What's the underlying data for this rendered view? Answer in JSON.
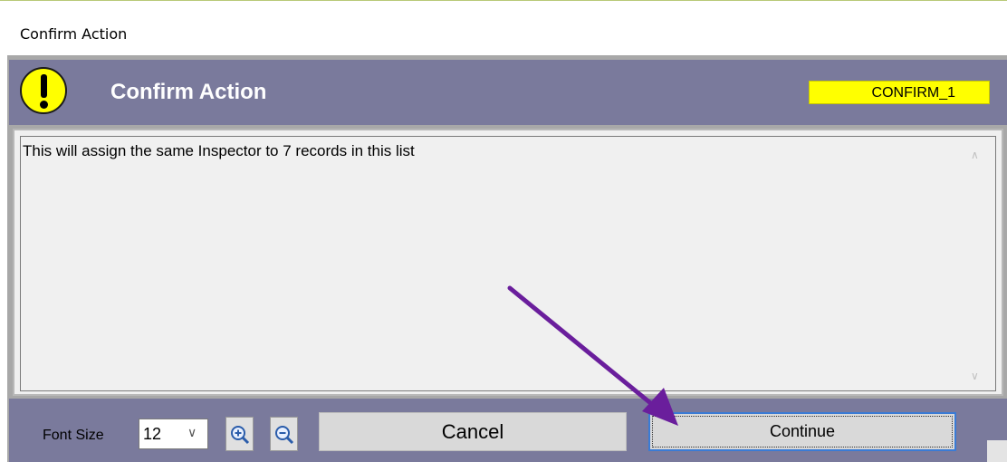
{
  "window": {
    "title": "Confirm Action"
  },
  "header": {
    "title": "Confirm Action",
    "code": "CONFIRM_1",
    "icon": "warning-icon"
  },
  "message": {
    "text": "This will assign the same Inspector to 7 records in this list"
  },
  "footer": {
    "font_size_label": "Font Size",
    "font_size_value": "12",
    "zoom_in_icon": "zoom-in-icon",
    "zoom_out_icon": "zoom-out-icon",
    "cancel_label": "Cancel",
    "continue_label": "Continue"
  },
  "colors": {
    "header_bg": "#7a7a9c",
    "code_badge_bg": "#ffff00",
    "focus_border": "#3a7bd5",
    "annotation_arrow": "#6a1e9c"
  }
}
